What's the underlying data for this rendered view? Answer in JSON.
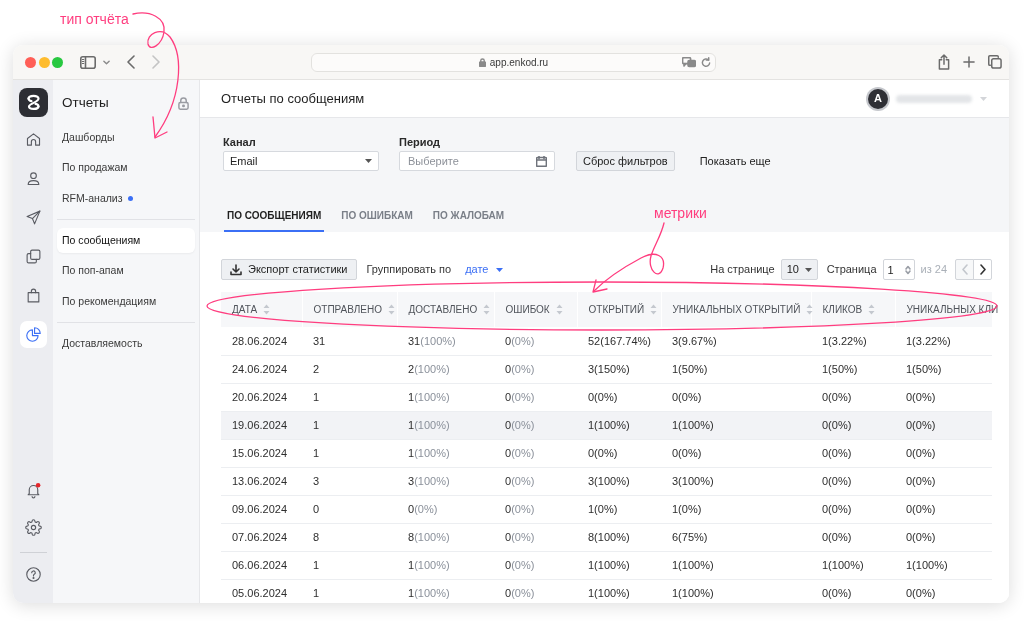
{
  "annotations": [
    {
      "text": "тип отчёта"
    },
    {
      "text": "метрики"
    }
  ],
  "browser": {
    "url": "app.enkod.ru",
    "back_disabled": false,
    "forward_disabled": true
  },
  "rail": {
    "items": [
      {
        "selected": false,
        "alert": false
      },
      {
        "selected": false,
        "alert": false
      },
      {
        "selected": false,
        "alert": false
      },
      {
        "selected": false,
        "alert": false
      },
      {
        "selected": false,
        "alert": false
      },
      {
        "selected": true,
        "alert": false
      }
    ],
    "bottom": [
      {
        "selected": false,
        "alert": true
      },
      {
        "selected": false,
        "alert": false
      },
      {
        "selected": false,
        "alert": false
      }
    ]
  },
  "sidebar": {
    "title": "Отчеты",
    "groups": [
      {
        "items": [
          {
            "label": "Дашборды",
            "selected": false,
            "marked": false
          },
          {
            "label": "По продажам",
            "selected": false,
            "marked": false
          },
          {
            "label": "RFM-анализ",
            "selected": false,
            "marked": true
          }
        ]
      },
      {
        "items": [
          {
            "label": "По сообщениям",
            "selected": true,
            "marked": false
          },
          {
            "label": "По поп-апам",
            "selected": false,
            "marked": false
          },
          {
            "label": "По рекомендациям",
            "selected": false,
            "marked": false
          }
        ]
      },
      {
        "items": [
          {
            "label": "Доставляемость",
            "selected": false,
            "marked": false
          }
        ]
      }
    ]
  },
  "header": {
    "title": "Отчеты по сообщениям",
    "user": {
      "initial": "A"
    }
  },
  "filters": {
    "fields": [
      {
        "kind": "select",
        "label": "Канал",
        "value": "Email"
      },
      {
        "kind": "date",
        "label": "Период",
        "placeholder": "Выберите"
      }
    ],
    "reset_button": "Сброс фильтров",
    "more_link": "Показать еще"
  },
  "tabs": [
    {
      "label": "ПО СООБЩЕНИЯМ",
      "selected": true
    },
    {
      "label": "ПО ОШИБКАМ",
      "selected": false
    },
    {
      "label": "ПО ЖАЛОБАМ",
      "selected": false
    }
  ],
  "toolbar": {
    "export_button": "Экспорт статистики",
    "group_by": {
      "label": "Группировать по",
      "value": "дате"
    }
  },
  "pagination": {
    "per_page_label": "На странице",
    "per_page": "10",
    "page_label": "Страница",
    "page": "1",
    "total": "из 24",
    "prev": {
      "disabled": true
    },
    "next": {
      "disabled": false
    }
  },
  "table": {
    "columns": [
      {
        "label": "ДАТА"
      },
      {
        "label": "ОТПРАВЛЕНО"
      },
      {
        "label": "ДОСТАВЛЕНО"
      },
      {
        "label": "ОШИБОК"
      },
      {
        "label": "ОТКРЫТИЙ"
      },
      {
        "label": "УНИКАЛЬНЫХ ОТКРЫТИЙ"
      },
      {
        "label": "КЛИКОВ"
      },
      {
        "label": "УНИКАЛЬНЫХ КЛИ"
      }
    ],
    "rows": [
      {
        "highlighted": false,
        "cells": [
          "28.06.2024",
          "31",
          {
            "count": "31",
            "share": "(100%)"
          },
          {
            "count": "0",
            "share": "(0%)"
          },
          "52(167.74%)",
          "3(9.67%)",
          "1(3.22%)",
          "1(3.22%)"
        ]
      },
      {
        "highlighted": false,
        "cells": [
          "24.06.2024",
          "2",
          {
            "count": "2",
            "share": "(100%)"
          },
          {
            "count": "0",
            "share": "(0%)"
          },
          "3(150%)",
          "1(50%)",
          "1(50%)",
          "1(50%)"
        ]
      },
      {
        "highlighted": false,
        "cells": [
          "20.06.2024",
          "1",
          {
            "count": "1",
            "share": "(100%)"
          },
          {
            "count": "0",
            "share": "(0%)"
          },
          "0(0%)",
          "0(0%)",
          "0(0%)",
          "0(0%)"
        ]
      },
      {
        "highlighted": true,
        "cells": [
          "19.06.2024",
          "1",
          {
            "count": "1",
            "share": "(100%)"
          },
          {
            "count": "0",
            "share": "(0%)"
          },
          "1(100%)",
          "1(100%)",
          "0(0%)",
          "0(0%)"
        ]
      },
      {
        "highlighted": false,
        "cells": [
          "15.06.2024",
          "1",
          {
            "count": "1",
            "share": "(100%)"
          },
          {
            "count": "0",
            "share": "(0%)"
          },
          "0(0%)",
          "0(0%)",
          "0(0%)",
          "0(0%)"
        ]
      },
      {
        "highlighted": false,
        "cells": [
          "13.06.2024",
          "3",
          {
            "count": "3",
            "share": "(100%)"
          },
          {
            "count": "0",
            "share": "(0%)"
          },
          "3(100%)",
          "3(100%)",
          "0(0%)",
          "0(0%)"
        ]
      },
      {
        "highlighted": false,
        "cells": [
          "09.06.2024",
          "0",
          {
            "count": "0",
            "share": "(0%)"
          },
          {
            "count": "0",
            "share": "(0%)"
          },
          "1(0%)",
          "1(0%)",
          "0(0%)",
          "0(0%)"
        ]
      },
      {
        "highlighted": false,
        "cells": [
          "07.06.2024",
          "8",
          {
            "count": "8",
            "share": "(100%)"
          },
          {
            "count": "0",
            "share": "(0%)"
          },
          "8(100%)",
          "6(75%)",
          "0(0%)",
          "0(0%)"
        ]
      },
      {
        "highlighted": false,
        "cells": [
          "06.06.2024",
          "1",
          {
            "count": "1",
            "share": "(100%)"
          },
          {
            "count": "0",
            "share": "(0%)"
          },
          "1(100%)",
          "1(100%)",
          "1(100%)",
          "1(100%)"
        ]
      },
      {
        "highlighted": false,
        "cells": [
          "05.06.2024",
          "1",
          {
            "count": "1",
            "share": "(100%)"
          },
          {
            "count": "0",
            "share": "(0%)"
          },
          "1(100%)",
          "1(100%)",
          "0(0%)",
          "0(0%)"
        ]
      }
    ]
  }
}
